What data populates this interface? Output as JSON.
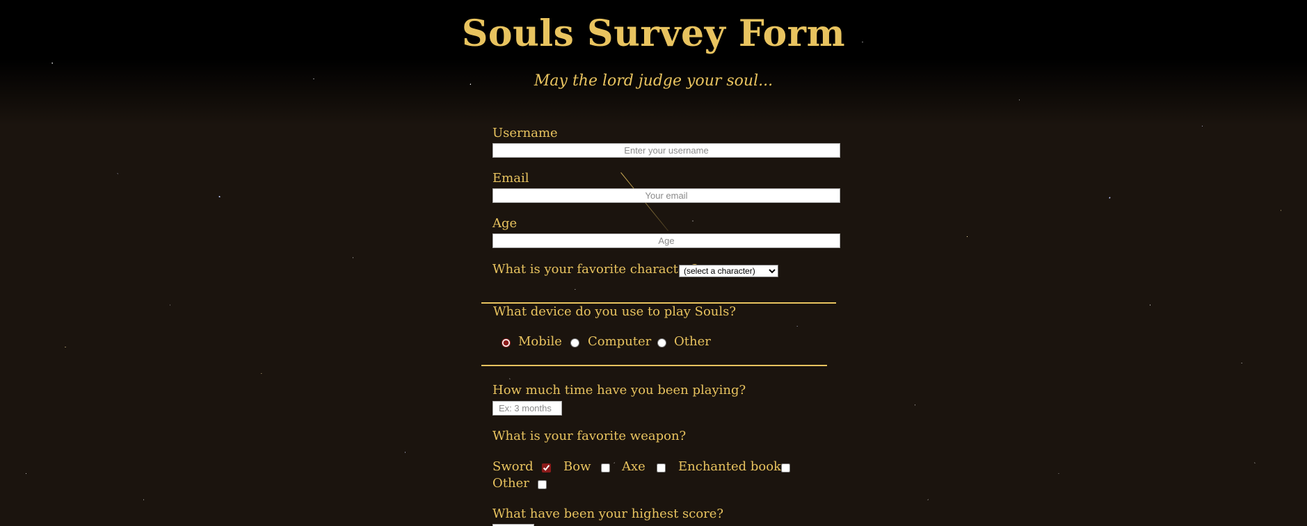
{
  "page": {
    "title": "Souls Survey Form",
    "subtitle": "May the lord judge your soul..."
  },
  "form": {
    "username": {
      "label": "Username",
      "placeholder": "Enter your username"
    },
    "email": {
      "label": "Email",
      "placeholder": "Your email"
    },
    "age": {
      "label": "Age",
      "placeholder": "Age"
    },
    "character": {
      "label": "What is your favorite character?",
      "selected": "(select a character)"
    },
    "device": {
      "label": "What device do you use to play Souls?",
      "options": [
        {
          "label": "Mobile",
          "checked": true
        },
        {
          "label": "Computer",
          "checked": false
        },
        {
          "label": "Other",
          "checked": false
        }
      ]
    },
    "play_time": {
      "label": "How much time have you been playing?",
      "placeholder": "Ex: 3 months"
    },
    "weapon": {
      "label": "What is your favorite weapon?",
      "options": [
        {
          "label": "Sword",
          "checked": true
        },
        {
          "label": "Bow",
          "checked": false
        },
        {
          "label": "Axe",
          "checked": false
        },
        {
          "label": "Enchanted book",
          "checked": false
        },
        {
          "label": "Other",
          "checked": false
        }
      ]
    },
    "score": {
      "label": "What have been your highest score?"
    }
  },
  "colors": {
    "accent": "#e8c35f",
    "background": "#1b140e",
    "checked": "#8b1a1a"
  }
}
